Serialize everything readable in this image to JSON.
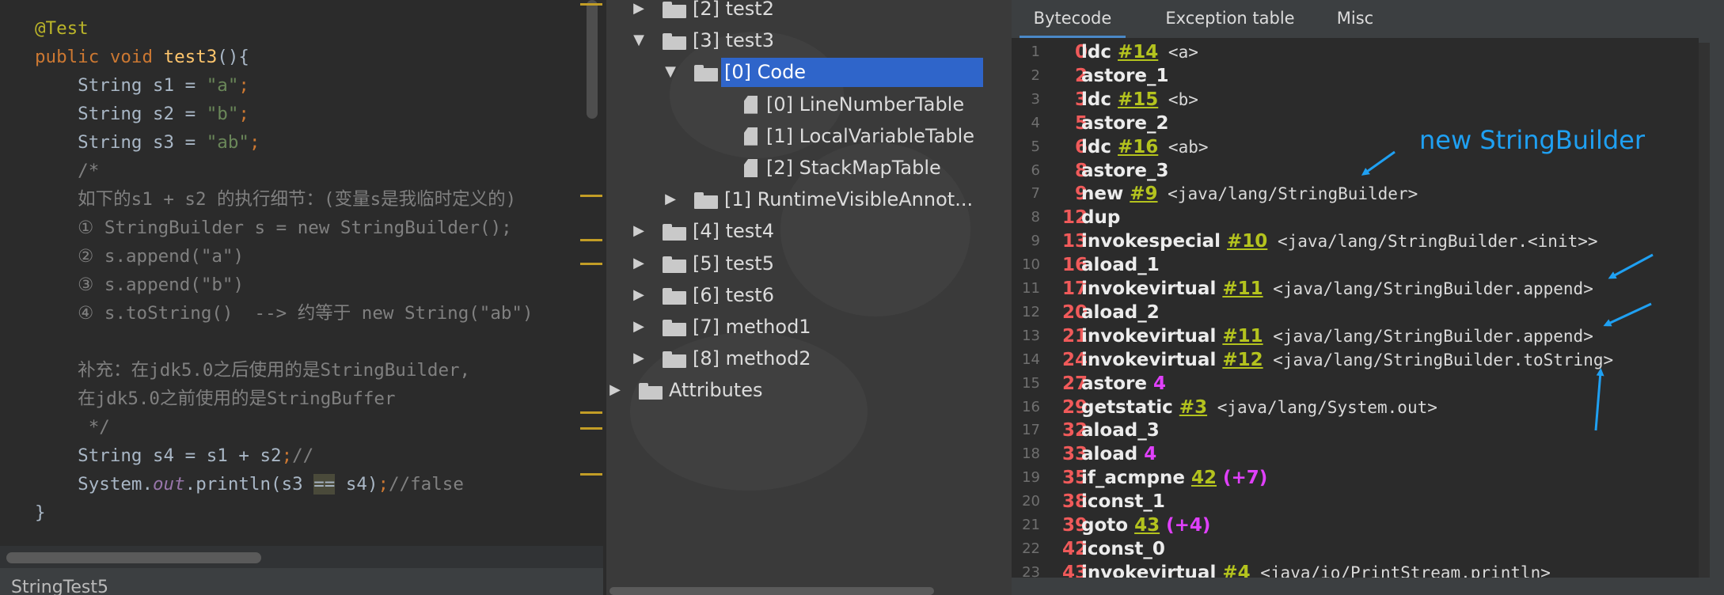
{
  "editor": {
    "lines": [
      [
        {
          "t": "@Test",
          "c": "tk-annotation"
        }
      ],
      [
        {
          "t": "public void ",
          "c": "tk-keyword"
        },
        {
          "t": "test3",
          "c": "tk-method"
        },
        {
          "t": "(){",
          "c": "tk-plain"
        }
      ],
      [
        {
          "t": "    String s1 = ",
          "c": "tk-plain"
        },
        {
          "t": "\"a\"",
          "c": "tk-string"
        },
        {
          "t": ";",
          "c": "tk-keyword"
        }
      ],
      [
        {
          "t": "    String s2 = ",
          "c": "tk-plain"
        },
        {
          "t": "\"b\"",
          "c": "tk-string"
        },
        {
          "t": ";",
          "c": "tk-keyword"
        }
      ],
      [
        {
          "t": "    String s3 = ",
          "c": "tk-plain"
        },
        {
          "t": "\"ab\"",
          "c": "tk-string"
        },
        {
          "t": ";",
          "c": "tk-keyword"
        }
      ],
      [
        {
          "t": "    /*",
          "c": "tk-comment"
        }
      ],
      [
        {
          "t": "    如下的s1 + s2 的执行细节：(变量s是我临时定义的)",
          "c": "tk-comment"
        }
      ],
      [
        {
          "t": "    ① StringBuilder s = new StringBuilder();",
          "c": "tk-comment"
        }
      ],
      [
        {
          "t": "    ② s.append(\"a\")",
          "c": "tk-comment"
        }
      ],
      [
        {
          "t": "    ③ s.append(\"b\")",
          "c": "tk-comment"
        }
      ],
      [
        {
          "t": "    ④ s.toString()  --> 约等于 new String(\"ab\")",
          "c": "tk-comment"
        }
      ],
      [
        {
          "t": "",
          "c": "tk-comment"
        }
      ],
      [
        {
          "t": "    补充：在jdk5.0之后使用的是StringBuilder,",
          "c": "tk-comment"
        }
      ],
      [
        {
          "t": "    在jdk5.0之前使用的是StringBuffer",
          "c": "tk-comment"
        }
      ],
      [
        {
          "t": "     */",
          "c": "tk-comment"
        }
      ],
      [
        {
          "t": "    String s4 = s1 + s2",
          "c": "tk-plain"
        },
        {
          "t": ";",
          "c": "tk-keyword"
        },
        {
          "t": "//",
          "c": "tk-comment"
        }
      ],
      [
        {
          "t": "    System.",
          "c": "tk-plain"
        },
        {
          "t": "out",
          "c": "tk-field"
        },
        {
          "t": ".println(s3 ",
          "c": "tk-plain"
        },
        {
          "t": "==",
          "c": "tk-highlight"
        },
        {
          "t": " s4)",
          "c": "tk-plain"
        },
        {
          "t": ";",
          "c": "tk-keyword"
        },
        {
          "t": "//false",
          "c": "tk-comment"
        }
      ],
      [
        {
          "t": "}",
          "c": "tk-plain"
        }
      ]
    ],
    "filename": "StringTest5"
  },
  "tree": {
    "rows": [
      {
        "label": "[2] test2",
        "kind": "folder",
        "arrow": "▶",
        "expanded": false,
        "depth": 1,
        "selected": false
      },
      {
        "label": "[3] test3",
        "kind": "folder",
        "arrow": "▼",
        "expanded": true,
        "depth": 1,
        "selected": false
      },
      {
        "label": "[0] Code",
        "kind": "folder",
        "arrow": "▼",
        "expanded": true,
        "depth": 2,
        "selected": true
      },
      {
        "label": "[0] LineNumberTable",
        "kind": "file",
        "arrow": "",
        "expanded": false,
        "depth": 3,
        "selected": false
      },
      {
        "label": "[1] LocalVariableTable",
        "kind": "file",
        "arrow": "",
        "expanded": false,
        "depth": 3,
        "selected": false
      },
      {
        "label": "[2] StackMapTable",
        "kind": "file",
        "arrow": "",
        "expanded": false,
        "depth": 3,
        "selected": false
      },
      {
        "label": "[1] RuntimeVisibleAnnot...",
        "kind": "folder",
        "arrow": "▶",
        "expanded": false,
        "depth": 2,
        "selected": false
      },
      {
        "label": "[4] test4",
        "kind": "folder",
        "arrow": "▶",
        "expanded": false,
        "depth": 1,
        "selected": false
      },
      {
        "label": "[5] test5",
        "kind": "folder",
        "arrow": "▶",
        "expanded": false,
        "depth": 1,
        "selected": false
      },
      {
        "label": "[6] test6",
        "kind": "folder",
        "arrow": "▶",
        "expanded": false,
        "depth": 1,
        "selected": false
      },
      {
        "label": "[7] method1",
        "kind": "folder",
        "arrow": "▶",
        "expanded": false,
        "depth": 1,
        "selected": false
      },
      {
        "label": "[8] method2",
        "kind": "folder",
        "arrow": "▶",
        "expanded": false,
        "depth": 1,
        "selected": false
      },
      {
        "label": "Attributes",
        "kind": "folder",
        "arrow": "▶",
        "expanded": false,
        "depth": 0,
        "selected": false
      }
    ]
  },
  "bytecode": {
    "tabs": [
      "Bytecode",
      "Exception table",
      "Misc"
    ],
    "active_tab": "Bytecode",
    "rows": [
      {
        "ln": "1",
        "off": "0",
        "parts": [
          {
            "t": "ldc ",
            "c": "op"
          },
          {
            "t": "#14",
            "c": "ref"
          },
          {
            "t": " <a>",
            "c": "arg"
          }
        ]
      },
      {
        "ln": "2",
        "off": "2",
        "parts": [
          {
            "t": "astore_1",
            "c": "op"
          }
        ]
      },
      {
        "ln": "3",
        "off": "3",
        "parts": [
          {
            "t": "ldc ",
            "c": "op"
          },
          {
            "t": "#15",
            "c": "ref"
          },
          {
            "t": " <b>",
            "c": "arg"
          }
        ]
      },
      {
        "ln": "4",
        "off": "5",
        "parts": [
          {
            "t": "astore_2",
            "c": "op"
          }
        ]
      },
      {
        "ln": "5",
        "off": "6",
        "parts": [
          {
            "t": "ldc ",
            "c": "op"
          },
          {
            "t": "#16",
            "c": "ref"
          },
          {
            "t": " <ab>",
            "c": "arg"
          }
        ]
      },
      {
        "ln": "6",
        "off": "8",
        "parts": [
          {
            "t": "astore_3",
            "c": "op"
          }
        ]
      },
      {
        "ln": "7",
        "off": "9",
        "parts": [
          {
            "t": "new ",
            "c": "op"
          },
          {
            "t": "#9",
            "c": "ref"
          },
          {
            "t": " <java/lang/StringBuilder>",
            "c": "arg"
          }
        ]
      },
      {
        "ln": "8",
        "off": "12",
        "parts": [
          {
            "t": "dup",
            "c": "op"
          }
        ]
      },
      {
        "ln": "9",
        "off": "13",
        "parts": [
          {
            "t": "invokespecial ",
            "c": "op"
          },
          {
            "t": "#10",
            "c": "ref"
          },
          {
            "t": " <java/lang/StringBuilder.<init>>",
            "c": "arg"
          }
        ]
      },
      {
        "ln": "10",
        "off": "16",
        "parts": [
          {
            "t": "aload_1",
            "c": "op"
          }
        ]
      },
      {
        "ln": "11",
        "off": "17",
        "parts": [
          {
            "t": "invokevirtual ",
            "c": "op"
          },
          {
            "t": "#11",
            "c": "ref"
          },
          {
            "t": " <java/lang/StringBuilder.append>",
            "c": "arg"
          }
        ]
      },
      {
        "ln": "12",
        "off": "20",
        "parts": [
          {
            "t": "aload_2",
            "c": "op"
          }
        ]
      },
      {
        "ln": "13",
        "off": "21",
        "parts": [
          {
            "t": "invokevirtual ",
            "c": "op"
          },
          {
            "t": "#11",
            "c": "ref"
          },
          {
            "t": " <java/lang/StringBuilder.append>",
            "c": "arg"
          }
        ]
      },
      {
        "ln": "14",
        "off": "24",
        "parts": [
          {
            "t": "invokevirtual ",
            "c": "op"
          },
          {
            "t": "#12",
            "c": "ref"
          },
          {
            "t": " <java/lang/StringBuilder.toString>",
            "c": "arg"
          }
        ]
      },
      {
        "ln": "15",
        "off": "27",
        "parts": [
          {
            "t": "astore ",
            "c": "op"
          },
          {
            "t": "4",
            "c": "num"
          }
        ]
      },
      {
        "ln": "16",
        "off": "29",
        "parts": [
          {
            "t": "getstatic ",
            "c": "op"
          },
          {
            "t": "#3",
            "c": "ref"
          },
          {
            "t": " <java/lang/System.out>",
            "c": "arg"
          }
        ]
      },
      {
        "ln": "17",
        "off": "32",
        "parts": [
          {
            "t": "aload_3",
            "c": "op"
          }
        ]
      },
      {
        "ln": "18",
        "off": "33",
        "parts": [
          {
            "t": "aload ",
            "c": "op"
          },
          {
            "t": "4",
            "c": "num"
          }
        ]
      },
      {
        "ln": "19",
        "off": "35",
        "parts": [
          {
            "t": "if_acmpne ",
            "c": "op"
          },
          {
            "t": "42",
            "c": "ref"
          },
          {
            "t": " (+7)",
            "c": "num"
          }
        ]
      },
      {
        "ln": "20",
        "off": "38",
        "parts": [
          {
            "t": "iconst_1",
            "c": "op"
          }
        ]
      },
      {
        "ln": "21",
        "off": "39",
        "parts": [
          {
            "t": "goto ",
            "c": "op"
          },
          {
            "t": "43",
            "c": "ref"
          },
          {
            "t": " (+4)",
            "c": "num"
          }
        ]
      },
      {
        "ln": "22",
        "off": "42",
        "parts": [
          {
            "t": "iconst_0",
            "c": "op"
          }
        ]
      },
      {
        "ln": "23",
        "off": "43",
        "parts": [
          {
            "t": "invokevirtual ",
            "c": "op"
          },
          {
            "t": "#4",
            "c": "ref"
          },
          {
            "t": " <java/io/PrintStream.println>",
            "c": "arg"
          }
        ]
      }
    ],
    "annotation": "new StringBuilder"
  }
}
